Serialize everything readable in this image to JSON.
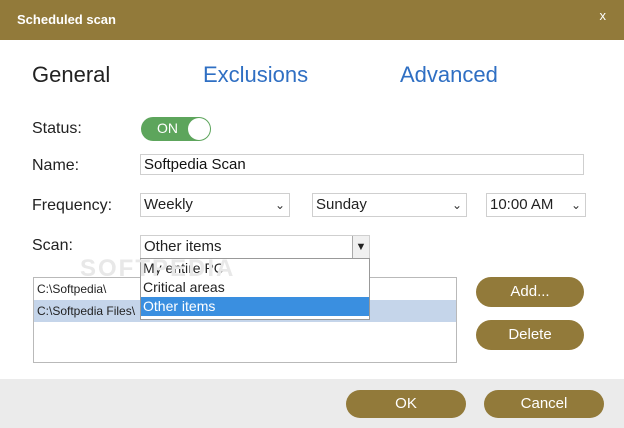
{
  "window": {
    "title": "Scheduled scan",
    "close_label": "x"
  },
  "tabs": [
    {
      "label": "General"
    },
    {
      "label": "Exclusions"
    },
    {
      "label": "Advanced"
    }
  ],
  "form": {
    "status_label": "Status:",
    "status_value": "ON",
    "name_label": "Name:",
    "name_value": "Softpedia Scan",
    "frequency_label": "Frequency:",
    "frequency_value": "Weekly",
    "day_value": "Sunday",
    "time_value": "10:00 AM",
    "scan_label": "Scan:",
    "scan_value": "Other items"
  },
  "scan_options": [
    "My entire PC",
    "Critical areas",
    "Other items"
  ],
  "paths": [
    "C:\\Softpedia\\",
    "C:\\Softpedia Files\\"
  ],
  "buttons": {
    "add": "Add...",
    "delete": "Delete",
    "ok": "OK",
    "cancel": "Cancel"
  },
  "watermark": "SOFTPEDIA",
  "icons": {
    "dropdown_arrow": "chevron-down-icon"
  },
  "colors": {
    "accent": "#927a3a",
    "toggle_on": "#5da55c",
    "tab_link": "#2f6fc3",
    "selected_option": "#3a8fe0"
  }
}
